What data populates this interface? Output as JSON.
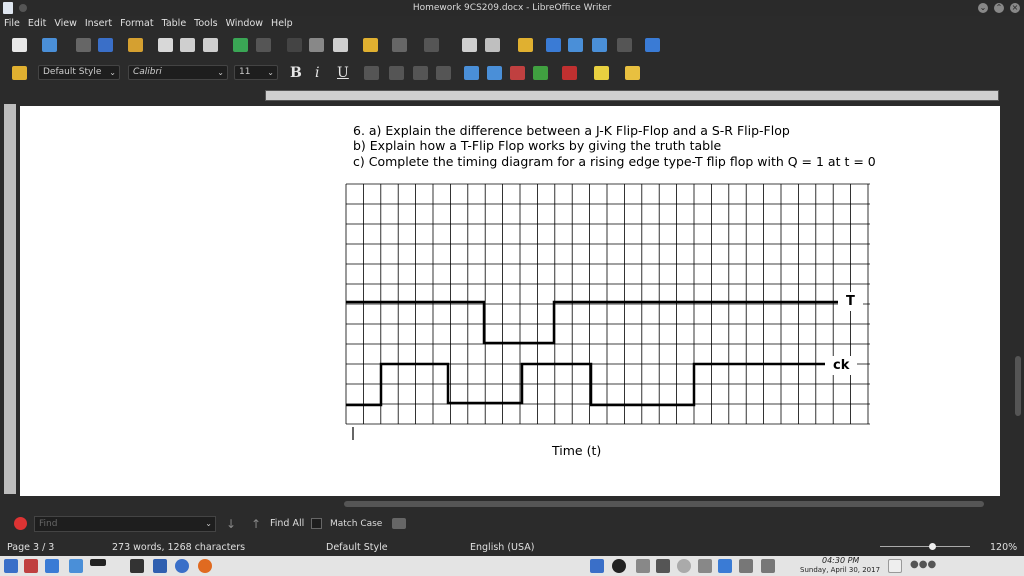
{
  "window": {
    "title": "Homework 9CS209.docx - LibreOffice Writer"
  },
  "menu": [
    "File",
    "Edit",
    "View",
    "Insert",
    "Format",
    "Table",
    "Tools",
    "Window",
    "Help"
  ],
  "formatting": {
    "paragraph_style": "Default Style",
    "font_name": "Calibri",
    "font_size": "11"
  },
  "document": {
    "question_line1": "6. a) Explain the difference between a J-K Flip-Flop and a S-R Flip-Flop",
    "question_line2": "b) Explain how a T-Flip Flop works by giving the truth table",
    "question_line3": "c) Complete the timing diagram for a rising edge type-T flip flop with Q = 1 at t = 0",
    "signal_t_label": "T",
    "signal_ck_label": "ck",
    "time_axis_label": "Time (t)"
  },
  "findbar": {
    "search_placeholder": "Find",
    "find_all_label": "Find All",
    "match_case_label": "Match Case"
  },
  "status": {
    "page": "Page 3 / 3",
    "word_count": "273 words, 1268 characters",
    "page_style": "Default Style",
    "language": "English (USA)",
    "zoom": "120%"
  },
  "taskbar": {
    "clock_time": "04:30 PM",
    "clock_date": "Sunday, April 30, 2017"
  },
  "colors": {
    "accent": "#3a7bd5",
    "page_bg": "#ffffff",
    "chrome_bg": "#2b2b2b"
  }
}
